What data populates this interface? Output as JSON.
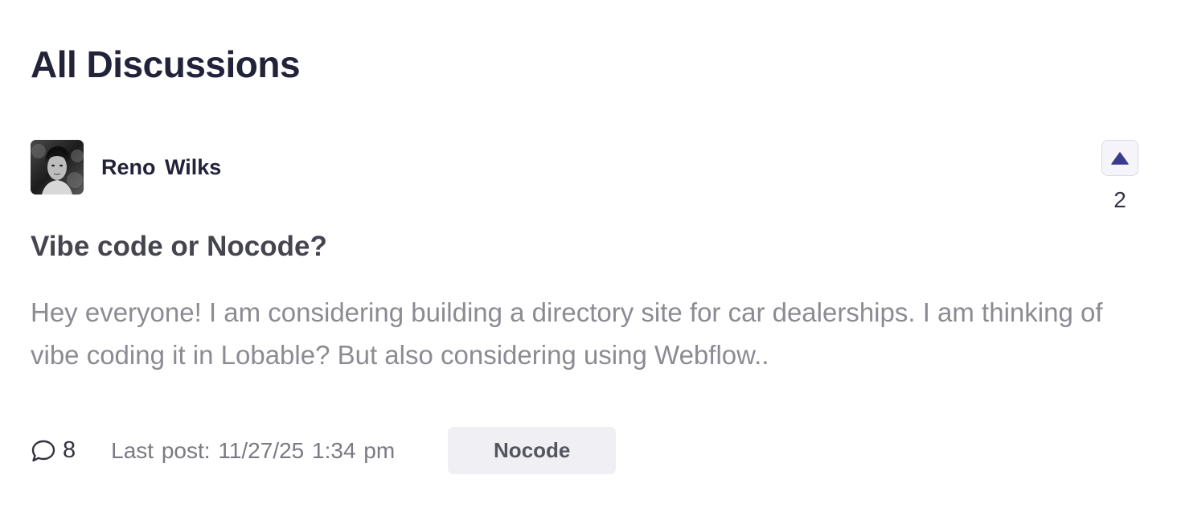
{
  "page": {
    "title": "All Discussions"
  },
  "post": {
    "author": {
      "name": "Reno Wilks"
    },
    "title": "Vibe code or Nocode?",
    "excerpt": "Hey everyone! I am considering building a directory site for car dealerships. I am thinking of vibe coding it in Lobable? But also considering using Webflow..",
    "votes": "2",
    "comment_count": "8",
    "last_post": "Last post: 11/27/25 1:34 pm",
    "tag": "Nocode",
    "icons": {
      "upvote": "triangle-up-icon",
      "comments": "chat-bubble-icon"
    },
    "colors": {
      "accent": "#3b3a8c",
      "tag_bg": "#f0f0f4"
    }
  }
}
